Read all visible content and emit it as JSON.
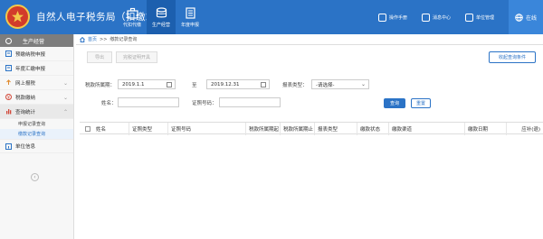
{
  "header": {
    "title": "自然人电子税务局（扣缴端）",
    "nav": [
      {
        "label": "代扣代缴",
        "icon": "briefcase-icon"
      },
      {
        "label": "生产经营",
        "icon": "coins-icon"
      },
      {
        "label": "年度申报",
        "icon": "document-icon"
      }
    ],
    "tools": [
      {
        "label": "操作手册",
        "icon": "book-icon"
      },
      {
        "label": "消息中心",
        "icon": "message-icon"
      },
      {
        "label": "单位管理",
        "icon": "building-icon"
      }
    ],
    "status": "在线"
  },
  "sidebar": {
    "heading": "生产经营",
    "items": [
      {
        "label": "预缴纳税申报",
        "icon": "form-icon",
        "chevron": false
      },
      {
        "label": "年度汇缴申报",
        "icon": "form-icon",
        "chevron": false
      },
      {
        "label": "网上报税",
        "icon": "upload-icon",
        "chevron": true
      },
      {
        "label": "税款缴纳",
        "icon": "pay-icon",
        "chevron": true
      },
      {
        "label": "查询统计",
        "icon": "chart-icon",
        "chevron": true
      }
    ],
    "subitems": [
      "申报记录查询",
      "缴款记录查询"
    ],
    "bottom_item": "单位信息"
  },
  "breadcrumb": {
    "home": "首页",
    "sep": ">>",
    "current": "缴款记录查询"
  },
  "actions": {
    "export": "导出",
    "print": "完税证明开具",
    "toggle_filter": "收起查询条件"
  },
  "filters": {
    "period_label": "税款所属期：",
    "period_start": "2019.1.1",
    "to_label": "至",
    "period_end": "2019.12.31",
    "report_type_label": "报表类型：",
    "report_type_value": "-请选择-",
    "name_label": "姓名：",
    "name_value": "",
    "id_label": "证照号码：",
    "id_value": "",
    "query_btn": "查询",
    "reset_btn": "重置"
  },
  "table": {
    "columns": [
      "姓名",
      "证照类型",
      "证照号码",
      "税款所属期起",
      "税款所属期止",
      "报表类型",
      "缴款状态",
      "缴款渠道",
      "缴款日期",
      "应补(退)"
    ]
  },
  "colors": {
    "primary": "#2b73c6",
    "header": "#2b73c6"
  }
}
